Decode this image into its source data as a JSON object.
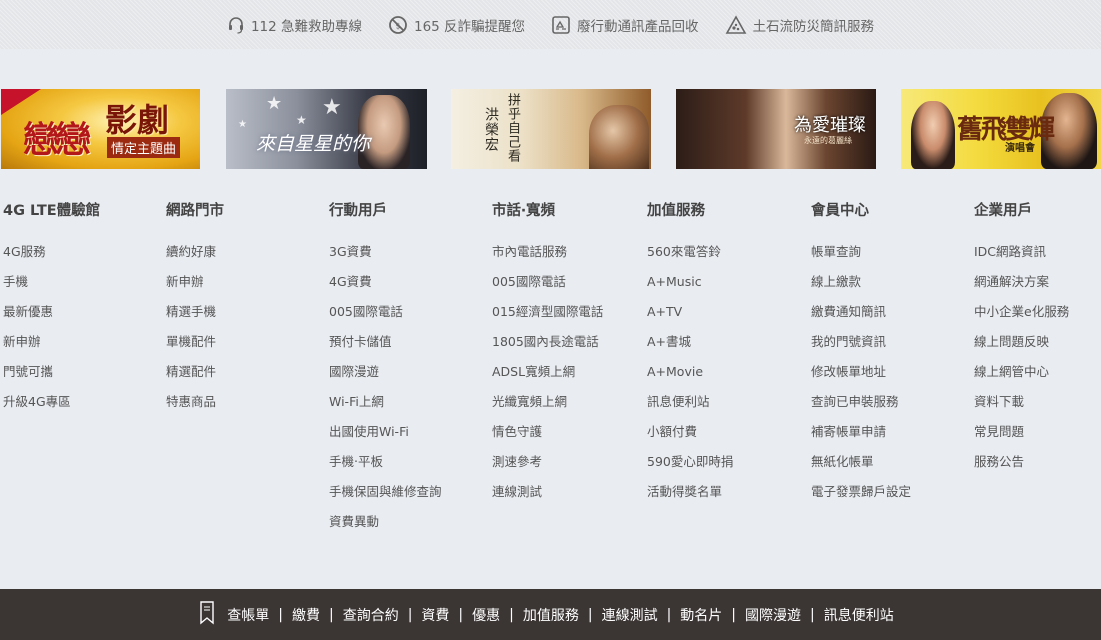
{
  "notices": [
    {
      "icon": "headset-icon",
      "label": "112 急難救助專線"
    },
    {
      "icon": "no-fraud-icon",
      "label": "165 反詐騙提醒您"
    },
    {
      "icon": "recycle-icon",
      "label": "廢行動通訊產品回收"
    },
    {
      "icon": "landslide-warning-icon",
      "label": "土石流防災簡訊服務"
    }
  ],
  "banners": [
    {
      "line1": "戀戀",
      "line2": "影劇",
      "line3": "情定主題曲"
    },
    {
      "line1": "來自星星的你"
    },
    {
      "line1": "拼乎自己看",
      "line2": "洪榮宏"
    },
    {
      "line1": "為愛璀璨",
      "line2": "永遠的葛麗絲"
    },
    {
      "line1": "舊飛雙輝",
      "line2": "演唱會"
    }
  ],
  "columns": [
    {
      "title": "4G LTE體驗館",
      "items": [
        "4G服務",
        "手機",
        "最新優惠",
        "新申辦",
        "門號可攜",
        "升級4G專區"
      ]
    },
    {
      "title": "網路門市",
      "items": [
        "續約好康",
        "新申辦",
        "精選手機",
        "單機配件",
        "精選配件",
        "特惠商品"
      ]
    },
    {
      "title": "行動用戶",
      "items": [
        "3G資費",
        "4G資費",
        "005國際電話",
        "預付卡儲值",
        "國際漫遊",
        "Wi-Fi上網",
        "出國使用Wi-Fi",
        "手機‧平板",
        "手機保固與維修查詢",
        "資費異動"
      ]
    },
    {
      "title": "市話‧寬頻",
      "items": [
        "市內電話服務",
        "005國際電話",
        "015經濟型國際電話",
        "1805國內長途電話",
        "ADSL寬頻上網",
        "光纖寬頻上網",
        "情色守護",
        "測速參考",
        "連線測試"
      ]
    },
    {
      "title": "加值服務",
      "items": [
        "560來電答鈴",
        "A+Music",
        "A+TV",
        "A+書城",
        "A+Movie",
        "訊息便利站",
        "小額付費",
        "590愛心即時捐",
        "活動得獎名單"
      ]
    },
    {
      "title": "會員中心",
      "items": [
        "帳單查詢",
        "線上繳款",
        "繳費通知簡訊",
        "我的門號資訊",
        "修改帳單地址",
        "查詢已申裝服務",
        "補寄帳單申請",
        "無紙化帳單",
        "電子發票歸戶設定"
      ]
    },
    {
      "title": "企業用戶",
      "items": [
        "IDC網路資訊",
        "網通解決方案",
        "中小企業e化服務",
        "線上問題反映",
        "線上網管中心",
        "資料下載",
        "常見問題",
        "服務公告"
      ]
    }
  ],
  "bottom_links": [
    "查帳單",
    "繳費",
    "查詢合約",
    "資費",
    "優惠",
    "加值服務",
    "連線測試",
    "動名片",
    "國際漫遊",
    "訊息便利站"
  ],
  "bottom_separator": "|",
  "colors": {
    "page_bg": "#e9ecf1",
    "bottom_bar_bg": "#3b3534",
    "heading": "#444444",
    "link": "#555555"
  }
}
